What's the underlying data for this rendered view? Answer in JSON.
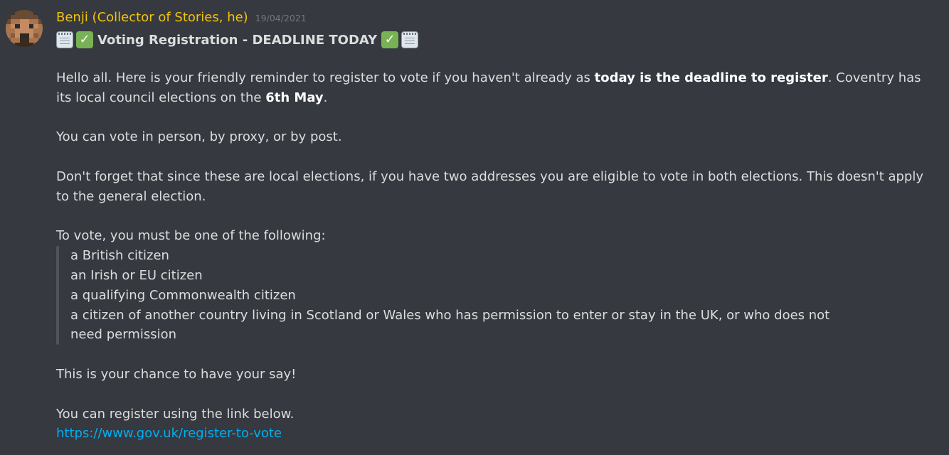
{
  "message": {
    "author": "Benji (Collector of Stories, he)",
    "timestamp": "19/04/2021",
    "title": "Voting Registration - DEADLINE TODAY",
    "title_icons": [
      "notepad-icon",
      "check-mark-icon"
    ],
    "para1": {
      "a": "Hello all. Here is your friendly reminder to register to vote if you haven't already as ",
      "b": "today is the deadline to register",
      "c": ". Coventry has its local council elections on the ",
      "d": "6th May",
      "e": "."
    },
    "para2": "You can vote in person, by proxy, or by post.",
    "para3": "Don't forget that since these are local elections, if you have two addresses you are eligible to vote in both elections. This doesn't apply to the general election.",
    "eligibility_intro": "To vote, you must be one of the following:",
    "eligibility": [
      "a British citizen",
      "an Irish or EU citizen",
      "a qualifying Commonwealth citizen",
      "a citizen of another country living in Scotland or Wales who has permission to enter or stay in the UK, or who does not need permission"
    ],
    "para4": "This is your chance to have your say!",
    "para5": "You can register using the link below.",
    "link": "https://www.gov.uk/register-to-vote"
  },
  "colors": {
    "background": "#36393f",
    "username": "#f1c40f",
    "text": "#dcddde",
    "timestamp": "#72767d",
    "link": "#00aff4",
    "quote_bar": "#4f545c"
  }
}
